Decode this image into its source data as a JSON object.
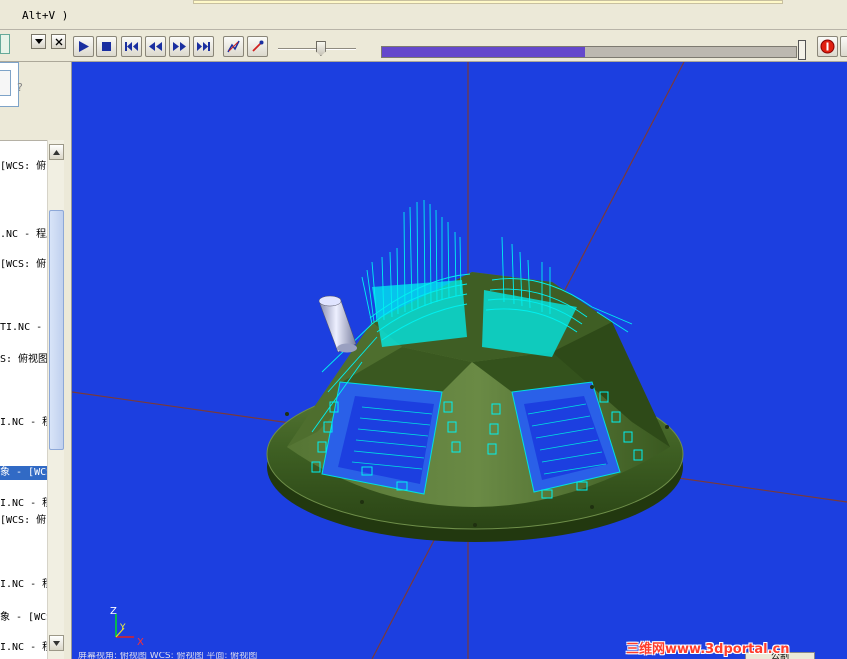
{
  "title_bar": {
    "shortcut_hint": "Alt+V )"
  },
  "toolbar": {
    "buttons": [
      {
        "name": "play",
        "icon": "play-icon"
      },
      {
        "name": "stop",
        "icon": "stop-icon"
      },
      {
        "name": "go-to-start",
        "icon": "skip-start-icon"
      },
      {
        "name": "step-back",
        "icon": "step-back-icon"
      },
      {
        "name": "step-forward",
        "icon": "step-forward-icon"
      },
      {
        "name": "go-to-end",
        "icon": "skip-end-icon"
      },
      {
        "name": "path-display",
        "icon": "toolpath-icon"
      },
      {
        "name": "tool-display",
        "icon": "tool-icon"
      },
      {
        "name": "stop-sim",
        "icon": "red-stop-icon"
      }
    ],
    "speed_slider_value": 0.55,
    "progress_fraction": 0.49,
    "accent_progress": "#6448cc"
  },
  "left_panel": {
    "help_glyph": "?",
    "items": [
      {
        "text": "[WCS: 俯",
        "selected": false
      },
      {
        "text": ".NC - 程序",
        "selected": false
      },
      {
        "text": "[WCS: 俯",
        "selected": false
      },
      {
        "text": "TI.NC -",
        "selected": false
      },
      {
        "text": "S: 俯视图",
        "selected": false
      },
      {
        "text": "I.NC - 程",
        "selected": false
      },
      {
        "text": "象 - [WCS",
        "selected": true
      },
      {
        "text": "I.NC - 程",
        "selected": false
      },
      {
        "text": "[WCS: 俯",
        "selected": false
      },
      {
        "text": "I.NC - 程",
        "selected": false
      },
      {
        "text": "象 - [WCS",
        "selected": false
      },
      {
        "text": "I.NC - 程",
        "selected": false
      }
    ]
  },
  "viewport": {
    "background": "#1c3fe0",
    "part_color": "#3d5e22",
    "toolpath_color": "#00f0f0",
    "axis_labels": {
      "x": "X",
      "y": "Y",
      "z": "Z"
    },
    "status_text": "屏幕视角: 俯视图   WCS: 俯视图   平面: 俯视图"
  },
  "watermark": "三维网www.3dportal.cn",
  "corner_tab": "公制"
}
